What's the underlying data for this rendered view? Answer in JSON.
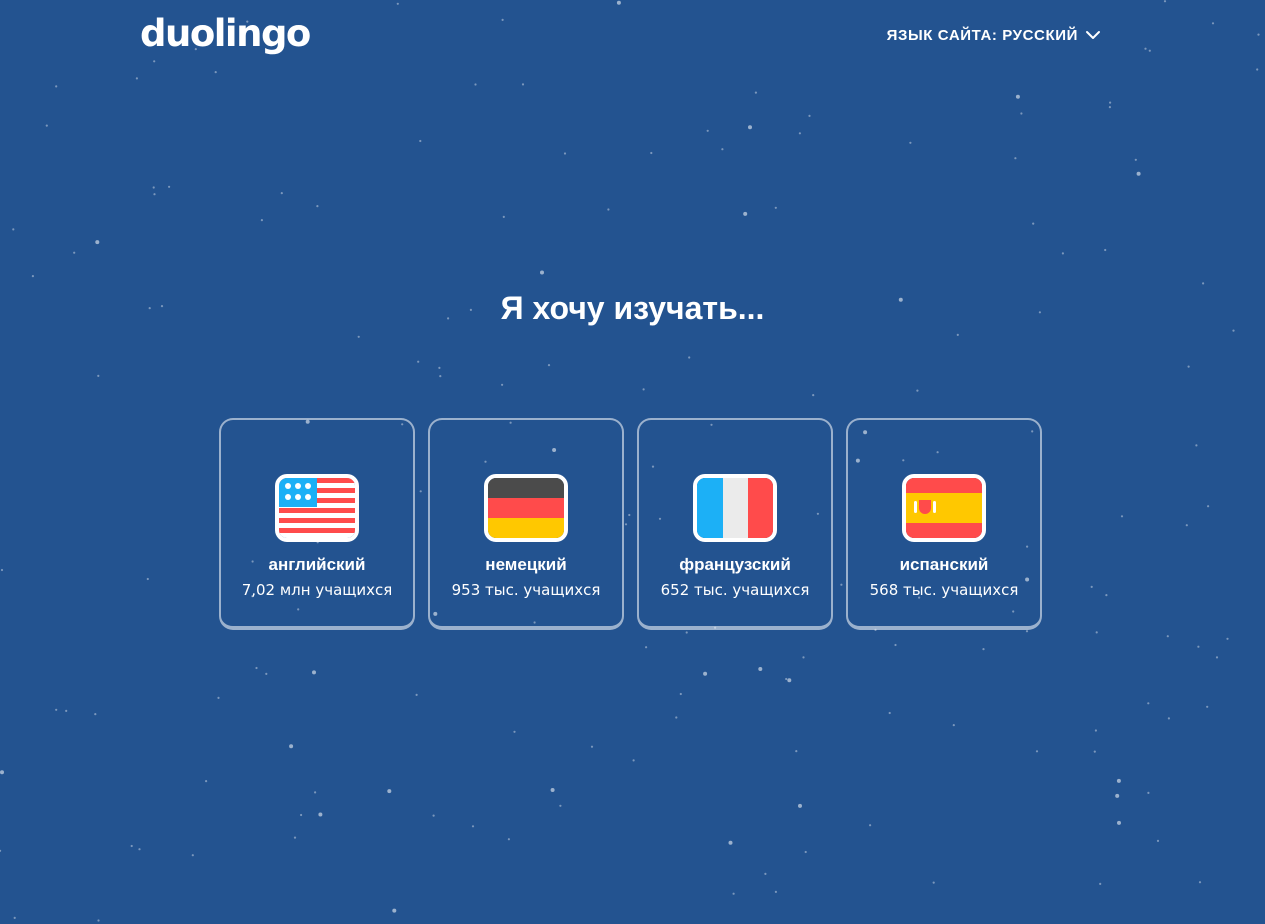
{
  "header": {
    "logo_text": "duolingo",
    "site_language_label": "ЯЗЫК САЙТА: РУССКИЙ"
  },
  "main": {
    "heading": "Я хочу изучать...",
    "courses": [
      {
        "name": "английский",
        "learners": "7,02 млн учащихся",
        "flag_icon": "us-flag-icon"
      },
      {
        "name": "немецкий",
        "learners": "953 тыс. учащихся",
        "flag_icon": "germany-flag-icon"
      },
      {
        "name": "французский",
        "learners": "652 тыс. учащихся",
        "flag_icon": "france-flag-icon"
      },
      {
        "name": "испанский",
        "learners": "568 тыс. учащихся",
        "flag_icon": "spain-flag-icon"
      }
    ]
  },
  "colors": {
    "background": "#235390",
    "text": "#ffffff",
    "card_border": "#9fb2cc"
  }
}
